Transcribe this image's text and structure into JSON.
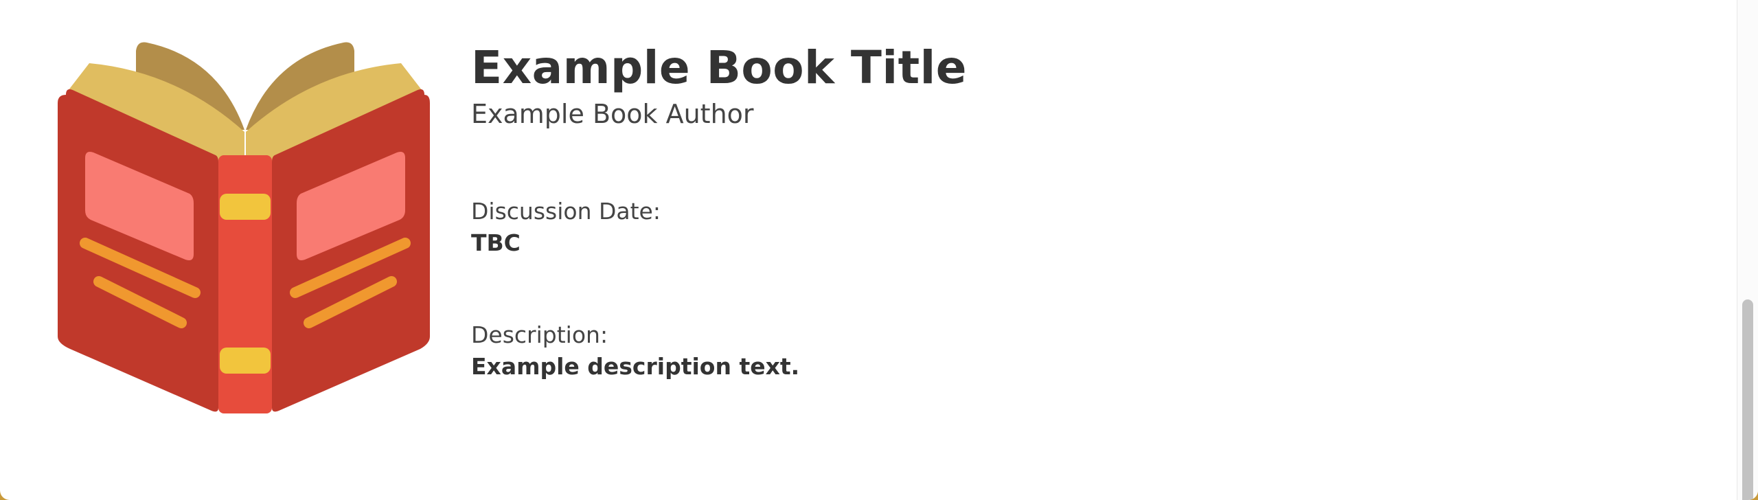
{
  "book": {
    "title": "Example Book Title",
    "author": "Example Book Author",
    "cover_icon": "open-book-icon"
  },
  "discussion": {
    "label": "Discussion Date:",
    "value": "TBC"
  },
  "description": {
    "label": "Description:",
    "value": "Example description text."
  },
  "colors": {
    "cover_red": "#c0392b",
    "spine_red": "#e74c3c",
    "page_yellow": "#e0bd60",
    "page_back": "#b38e4a",
    "label_pink": "#f97b72",
    "stripe_orange": "#f0982f",
    "band_yellow": "#f2c53d",
    "text_dark": "#333333"
  }
}
